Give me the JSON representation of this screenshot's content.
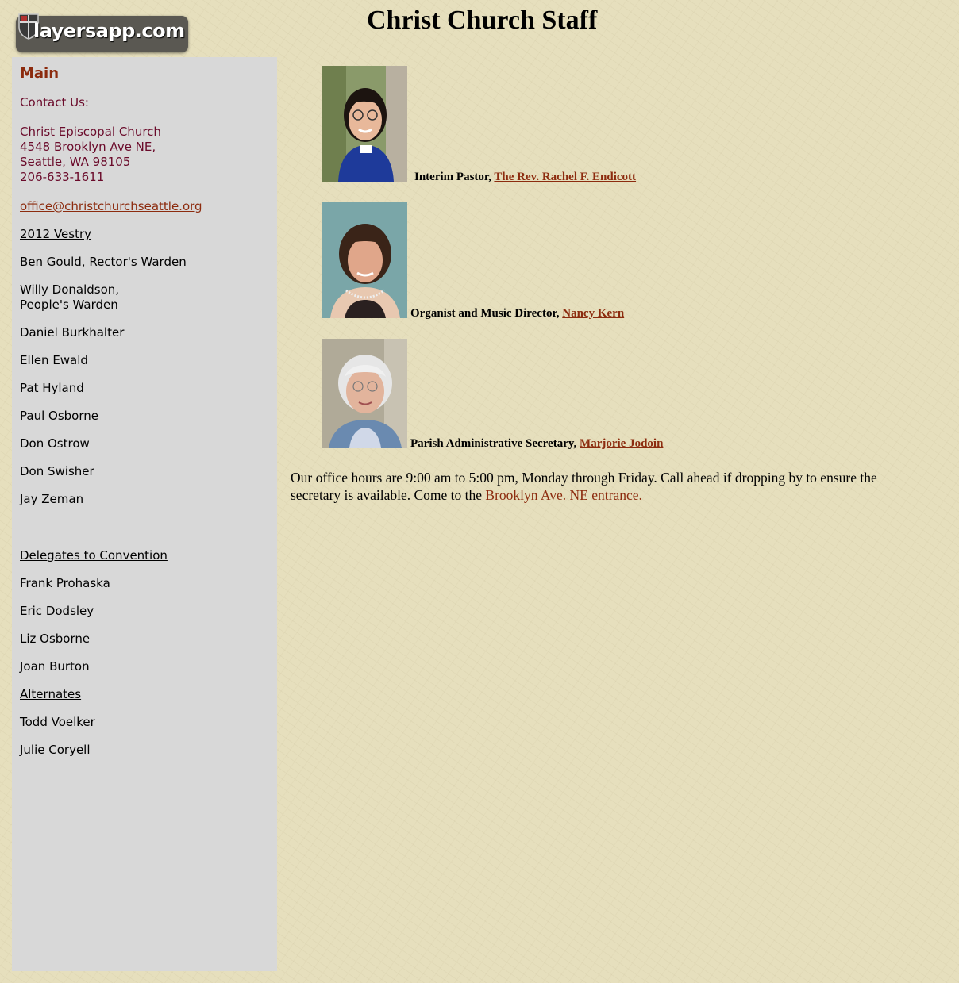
{
  "logo": {
    "text": "layersapp.com"
  },
  "page_title": "Christ Church Staff",
  "sidebar": {
    "main_link": "Main",
    "contact_heading": "Contact Us:",
    "address_lines": [
      "Christ Episcopal Church",
      "4548 Brooklyn Ave NE,",
      "Seattle, WA 98105",
      "206-633-1611"
    ],
    "email": "office@christchurchseattle.org",
    "vestry_heading": "2012 Vestry",
    "vestry": [
      "Ben Gould, Rector's Warden",
      "Willy Donaldson,",
      "People's Warden",
      "Daniel Burkhalter",
      "Ellen Ewald",
      "Pat Hyland",
      "Paul Osborne",
      "Don Ostrow",
      "Don Swisher",
      "Jay Zeman"
    ],
    "delegates_heading": "Delegates to Convention",
    "delegates": [
      "Frank Prohaska",
      "Eric Dodsley",
      "Liz Osborne",
      "Joan Burton"
    ],
    "alternates_heading": "Alternates",
    "alternates": [
      "Todd Voelker",
      "Julie Coryell"
    ]
  },
  "staff": [
    {
      "role": "Interim Pastor,",
      "name": "The Rev. Rachel F. Endicott"
    },
    {
      "role": "Organist and Music Director,",
      "name": "Nancy Kern"
    },
    {
      "role": "Parish Administrative Secretary,",
      "name": "Marjorie Jodoin"
    }
  ],
  "office_hours": {
    "text": "Our office hours are 9:00 am to 5:00 pm, Monday through Friday. Call ahead if dropping by to ensure the secretary is available. Come to the",
    "link": "Brooklyn Ave. NE entrance."
  }
}
